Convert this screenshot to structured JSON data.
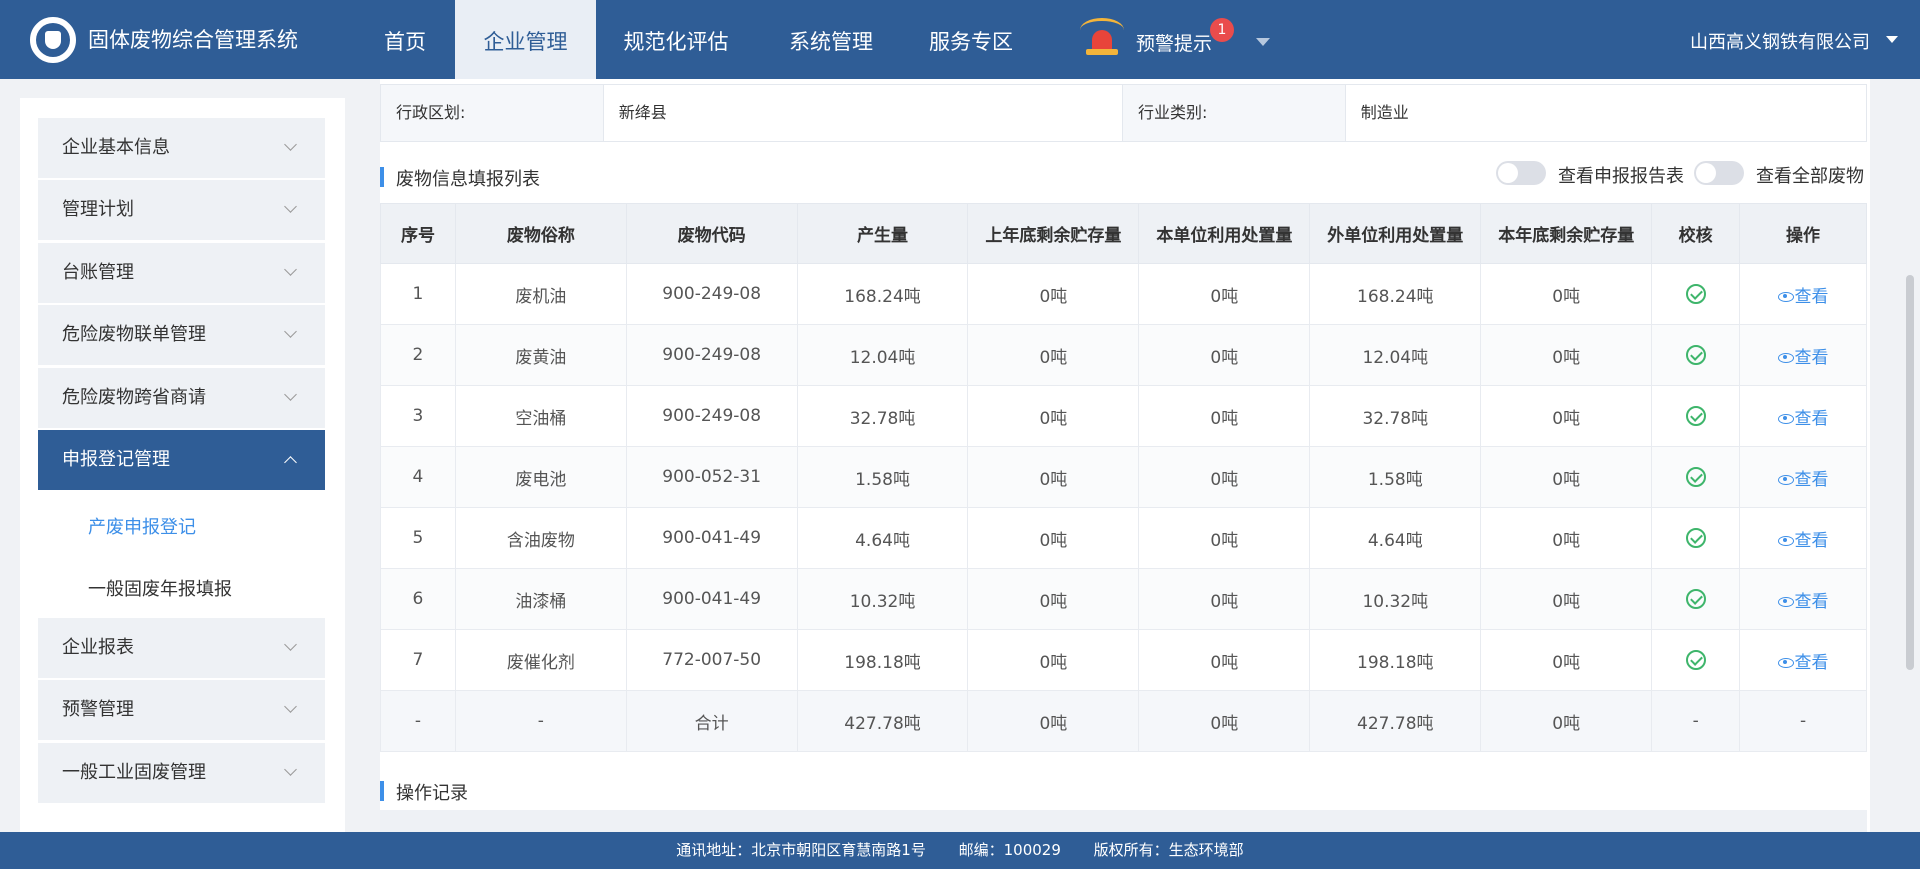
{
  "header": {
    "app_name": "固体废物综合管理系统",
    "nav": [
      "首页",
      "企业管理",
      "规范化评估",
      "系统管理",
      "服务专区"
    ],
    "active_nav": "企业管理",
    "alert_label": "预警提示",
    "alert_count": "1",
    "company": "山西高义钢铁有限公司",
    "brand_color": "#2f5d96"
  },
  "sidebar": {
    "menus": [
      "企业基本信息",
      "管理计划",
      "台账管理",
      "危险废物联单管理",
      "危险废物跨省商请",
      "申报登记管理"
    ],
    "submenus": [
      "产废申报登记",
      "一般固废年报填报"
    ],
    "menus_after": [
      "企业报表",
      "预警管理",
      "一般工业固废管理"
    ],
    "active_menu": "申报登记管理",
    "active_submenu": "产废申报登记"
  },
  "info": {
    "region_label": "行政区划:",
    "region_value": "新绛县",
    "industry_label": "行业类别:",
    "industry_value": "制造业"
  },
  "list": {
    "title": "废物信息填报列表",
    "toggle1": "查看申报报告表",
    "toggle2": "查看全部废物",
    "headers": [
      "序号",
      "废物俗称",
      "废物代码",
      "产生量",
      "上年底剩余贮存量",
      "本单位利用处置量",
      "外单位利用处置量",
      "本年底剩余贮存量",
      "校核",
      "操作"
    ],
    "rows": [
      [
        "1",
        "废机油",
        "900-249-08",
        "168.24吨",
        "0吨",
        "0吨",
        "168.24吨",
        "0吨"
      ],
      [
        "2",
        "废黄油",
        "900-249-08",
        "12.04吨",
        "0吨",
        "0吨",
        "12.04吨",
        "0吨"
      ],
      [
        "3",
        "空油桶",
        "900-249-08",
        "32.78吨",
        "0吨",
        "0吨",
        "32.78吨",
        "0吨"
      ],
      [
        "4",
        "废电池",
        "900-052-31",
        "1.58吨",
        "0吨",
        "0吨",
        "1.58吨",
        "0吨"
      ],
      [
        "5",
        "含油废物",
        "900-041-49",
        "4.64吨",
        "0吨",
        "0吨",
        "4.64吨",
        "0吨"
      ],
      [
        "6",
        "油漆桶",
        "900-041-49",
        "10.32吨",
        "0吨",
        "0吨",
        "10.32吨",
        "0吨"
      ],
      [
        "7",
        "废催化剂",
        "772-007-50",
        "198.18吨",
        "0吨",
        "0吨",
        "198.18吨",
        "0吨"
      ]
    ],
    "view_label": "查看",
    "total_row": [
      "-",
      "-",
      "合计",
      "427.78吨",
      "0吨",
      "0吨",
      "427.78吨",
      "0吨",
      "-",
      "-"
    ]
  },
  "oprec": {
    "title": "操作记录"
  },
  "footer": {
    "address": "通讯地址：北京市朝阳区育慧南路1号",
    "postcode": "邮编：100029",
    "copyright": "版权所有：生态环境部"
  }
}
